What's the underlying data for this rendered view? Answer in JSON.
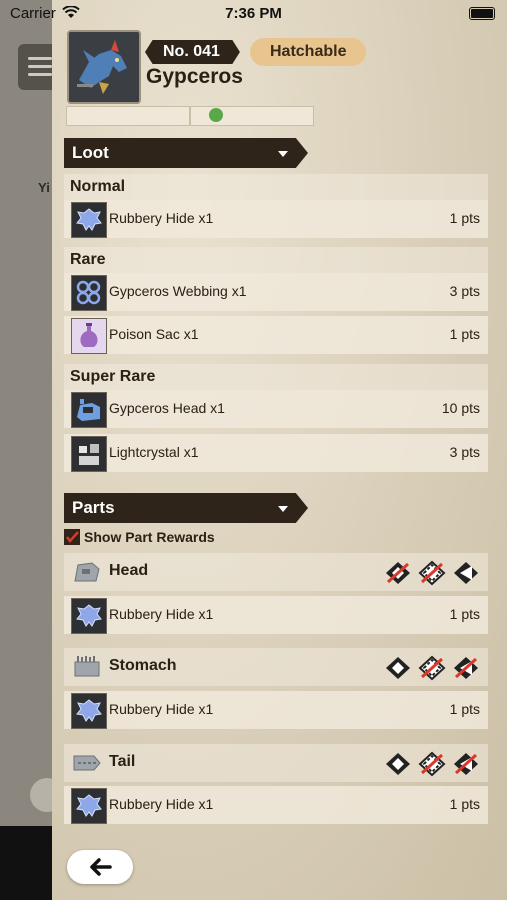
{
  "status_bar": {
    "carrier": "Carrier",
    "time": "7:36 PM"
  },
  "background": {
    "partial_text": "Yi"
  },
  "monster": {
    "number": "No. 041",
    "hatch_status": "Hatchable",
    "name": "Gypceros"
  },
  "loot": {
    "section_title": "Loot",
    "groups": [
      {
        "title": "Normal",
        "items": [
          {
            "name": "Rubbery Hide x1",
            "points": "1 pts",
            "icon": "hide-icon"
          }
        ]
      },
      {
        "title": "Rare",
        "items": [
          {
            "name": "Gypceros Webbing x1",
            "points": "3 pts",
            "icon": "webbing-icon"
          },
          {
            "name": "Poison Sac x1",
            "points": "1 pts",
            "icon": "poison-sac-icon"
          }
        ]
      },
      {
        "title": "Super Rare",
        "items": [
          {
            "name": "Gypceros Head x1",
            "points": "10 pts",
            "icon": "head-item-icon"
          },
          {
            "name": "Lightcrystal x1",
            "points": "3 pts",
            "icon": "lightcrystal-icon"
          }
        ]
      }
    ]
  },
  "parts": {
    "section_title": "Parts",
    "show_rewards_label": "Show Part Rewards",
    "show_rewards_checked": true,
    "list": [
      {
        "name": "Head",
        "reward": {
          "name": "Rubbery Hide x1",
          "points": "1 pts"
        }
      },
      {
        "name": "Stomach",
        "reward": {
          "name": "Rubbery Hide x1",
          "points": "1 pts"
        }
      },
      {
        "name": "Tail",
        "reward": {
          "name": "Rubbery Hide x1",
          "points": "1 pts"
        }
      }
    ]
  },
  "colors": {
    "dark_bar": "#2e2419",
    "badge_gold": "#e8c48e",
    "check_red": "#d9382a"
  }
}
